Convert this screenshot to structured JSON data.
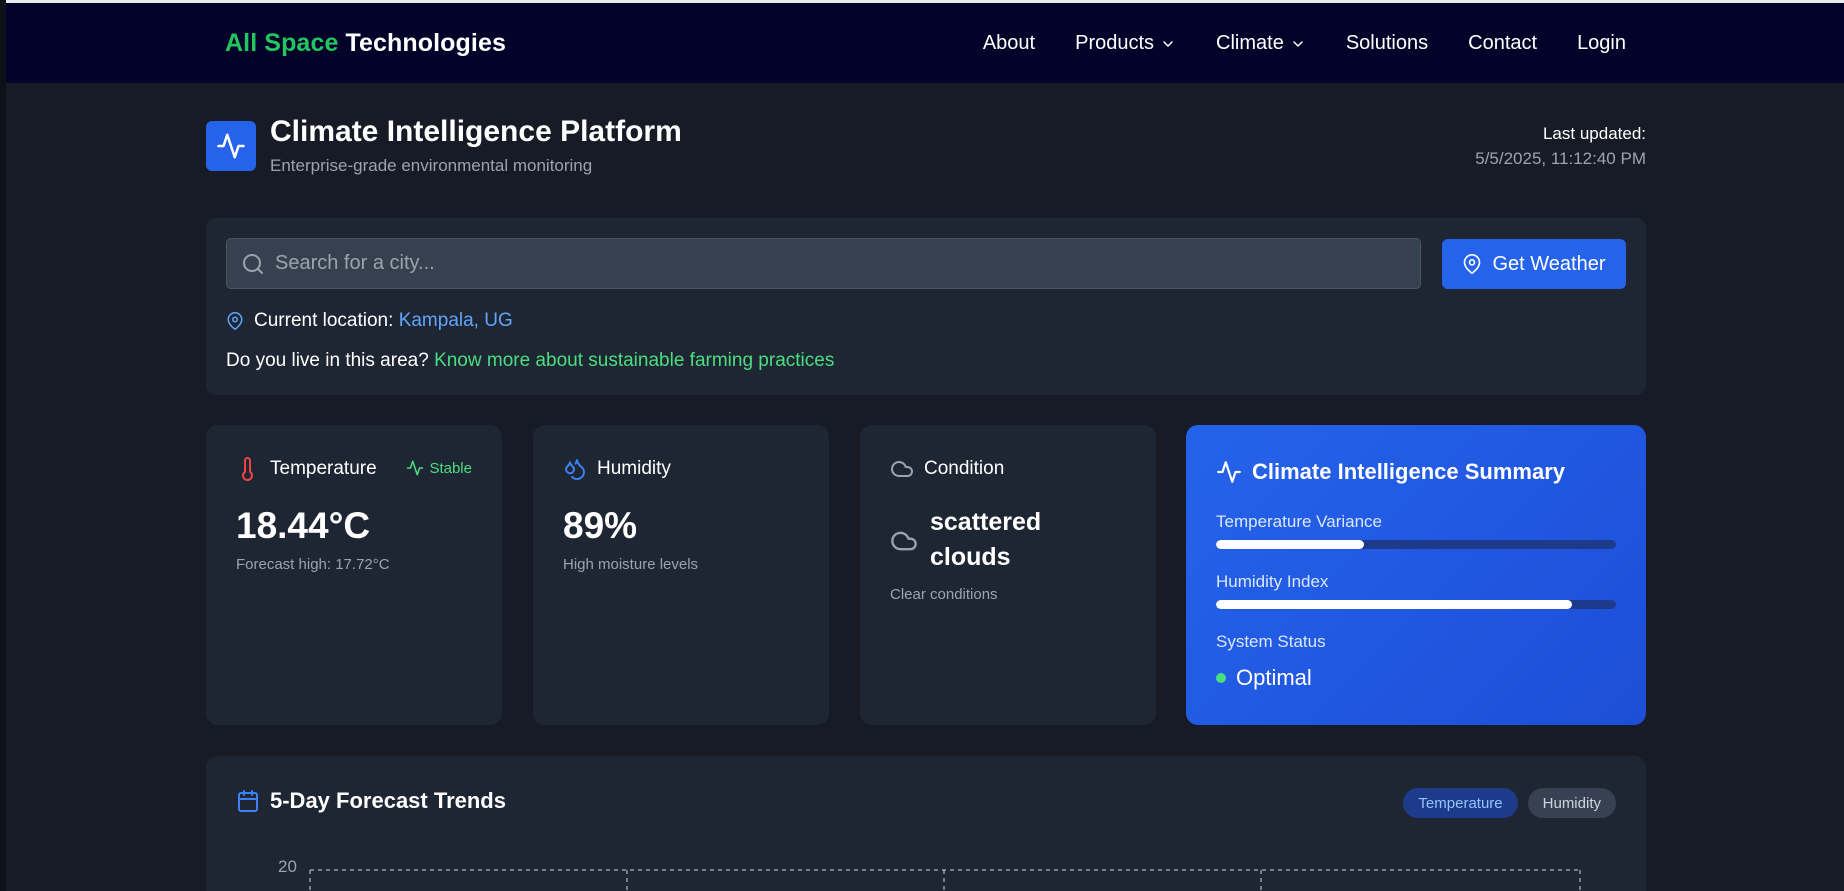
{
  "nav": {
    "brand_green": "All Space",
    "brand_white": "Technologies",
    "links": [
      {
        "label": "About",
        "dropdown": false
      },
      {
        "label": "Products",
        "dropdown": true
      },
      {
        "label": "Climate",
        "dropdown": true
      },
      {
        "label": "Solutions",
        "dropdown": false
      },
      {
        "label": "Contact",
        "dropdown": false
      },
      {
        "label": "Login",
        "dropdown": false
      }
    ]
  },
  "header": {
    "title": "Climate Intelligence Platform",
    "subtitle": "Enterprise-grade environmental monitoring",
    "last_updated_label": "Last updated:",
    "last_updated_value": "5/5/2025, 11:12:40 PM",
    "icon": "activity-icon"
  },
  "search": {
    "placeholder": "Search for a city...",
    "value": "",
    "button_label": "Get Weather",
    "current_location_label": "Current location:",
    "current_location_value": "Kampala, UG",
    "prompt_text": "Do you live in this area?",
    "prompt_link": "Know more about sustainable farming practices"
  },
  "cards": {
    "temperature": {
      "label": "Temperature",
      "badge": "Stable",
      "value": "18.44°C",
      "note": "Forecast high: 17.72°C"
    },
    "humidity": {
      "label": "Humidity",
      "value": "89%",
      "note": "High moisture levels"
    },
    "condition": {
      "label": "Condition",
      "value": "scattered clouds",
      "note": "Clear conditions"
    }
  },
  "summary": {
    "title": "Climate Intelligence Summary",
    "temperature_variance_label": "Temperature Variance",
    "temperature_variance_level": 0.37,
    "humidity_index_label": "Humidity Index",
    "humidity_index_level": 0.89,
    "system_status_label": "System Status",
    "system_status_value": "Optimal"
  },
  "forecast": {
    "title": "5-Day Forecast Trends",
    "toggle_active": "Temperature",
    "toggle_inactive": "Humidity",
    "y_top_tick": "20"
  },
  "colors": {
    "nav_bg": "#03032a",
    "page_bg": "#161b26",
    "card_bg": "#1f2633",
    "accent_blue": "#2563eb",
    "accent_green": "#22c55e",
    "link_blue": "#60a5fa",
    "temp_red": "#ef4444"
  }
}
